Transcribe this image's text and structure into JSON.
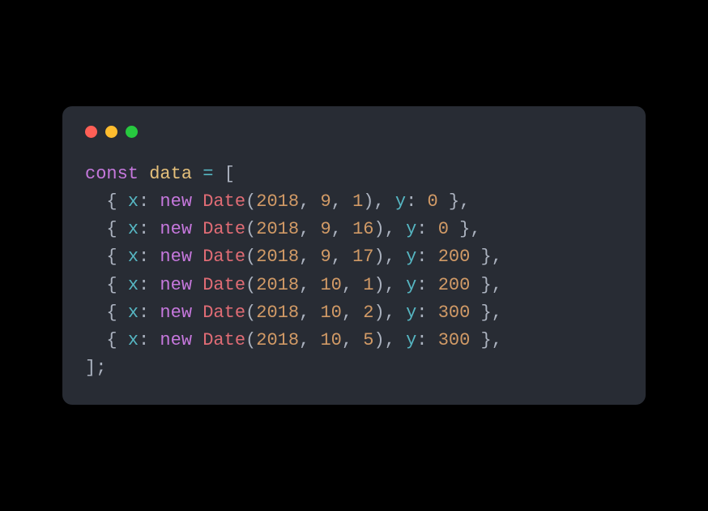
{
  "titlebar": {
    "dots": [
      "red",
      "yellow",
      "green"
    ]
  },
  "code": {
    "declKeyword": "const",
    "varName": "data",
    "assignOp": "=",
    "openBracket": "[",
    "closeBracket": "]",
    "semicolon": ";",
    "indent": "  ",
    "lineTemplate": {
      "openBrace": "{",
      "propX": "x",
      "colon": ":",
      "newKw": "new",
      "className": "Date",
      "openParen": "(",
      "closeParen": ")",
      "commaSpace": ", ",
      "propY": "y",
      "closeBrace": "}",
      "trailingComma": ","
    },
    "rows": [
      {
        "dateArgs": [
          "2018",
          "9",
          "1"
        ],
        "y": "0"
      },
      {
        "dateArgs": [
          "2018",
          "9",
          "16"
        ],
        "y": "0"
      },
      {
        "dateArgs": [
          "2018",
          "9",
          "17"
        ],
        "y": "200"
      },
      {
        "dateArgs": [
          "2018",
          "10",
          "1"
        ],
        "y": "200"
      },
      {
        "dateArgs": [
          "2018",
          "10",
          "2"
        ],
        "y": "300"
      },
      {
        "dateArgs": [
          "2018",
          "10",
          "5"
        ],
        "y": "300"
      }
    ]
  },
  "colors": {
    "bg": "#000000",
    "windowBg": "#282c34",
    "red": "#ff5f56",
    "yellow": "#ffbd2e",
    "green": "#27c93f",
    "keyword": "#c678dd",
    "variable": "#e5c07b",
    "operator": "#56b6c2",
    "punct": "#abb2bf",
    "prop": "#56b6c2",
    "class": "#e06c75",
    "number": "#d19a66"
  }
}
